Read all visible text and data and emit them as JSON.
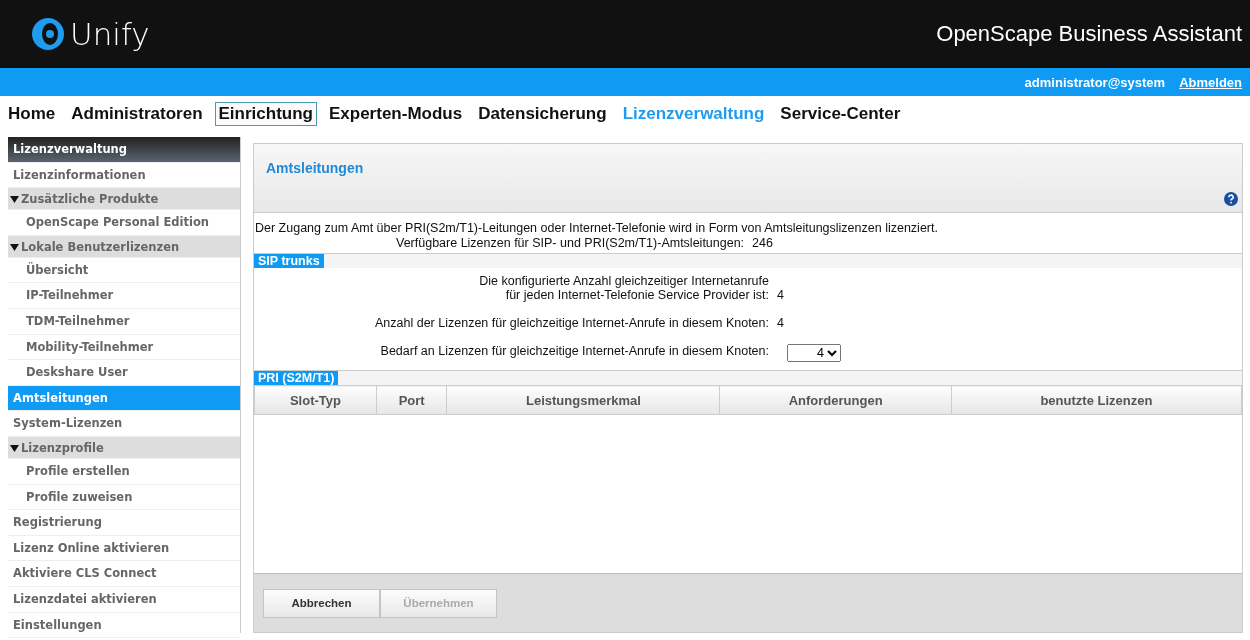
{
  "header": {
    "logo": "Unify",
    "product": "OpenScape Business Assistant"
  },
  "user_bar": {
    "user": "administrator@system",
    "logout": "Abmelden"
  },
  "nav": [
    {
      "label": "Home",
      "selected": false,
      "focused": false
    },
    {
      "label": "Administratoren",
      "selected": false,
      "focused": false
    },
    {
      "label": "Einrichtung",
      "selected": false,
      "focused": true
    },
    {
      "label": "Experten-Modus",
      "selected": false,
      "focused": false
    },
    {
      "label": "Datensicherung",
      "selected": false,
      "focused": false
    },
    {
      "label": "Lizenzverwaltung",
      "selected": true,
      "focused": false
    },
    {
      "label": "Service-Center",
      "selected": false,
      "focused": false
    }
  ],
  "sidebar": {
    "items": [
      {
        "kind": "header",
        "label": "Lizenzverwaltung",
        "selected": false
      },
      {
        "kind": "item",
        "label": "Lizenzinformationen",
        "selected": false
      },
      {
        "kind": "group",
        "label": "Zusätzliche Produkte",
        "expanded": true,
        "selected": false,
        "children": [
          {
            "kind": "subitem",
            "label": "OpenScape Personal Edition",
            "selected": false
          }
        ]
      },
      {
        "kind": "group",
        "label": "Lokale Benutzerlizenzen",
        "expanded": true,
        "selected": false,
        "children": [
          {
            "kind": "subitem",
            "label": "Übersicht",
            "selected": false
          },
          {
            "kind": "subitem",
            "label": "IP-Teilnehmer",
            "selected": false
          },
          {
            "kind": "subitem",
            "label": "TDM-Teilnehmer",
            "selected": false
          },
          {
            "kind": "subitem",
            "label": "Mobility-Teilnehmer",
            "selected": false
          },
          {
            "kind": "subitem",
            "label": "Deskshare User",
            "selected": false
          }
        ]
      },
      {
        "kind": "item",
        "label": "Amtsleitungen",
        "selected": true
      },
      {
        "kind": "item",
        "label": "System-Lizenzen",
        "selected": false
      },
      {
        "kind": "group",
        "label": "Lizenzprofile",
        "expanded": true,
        "selected": false,
        "children": [
          {
            "kind": "subitem",
            "label": "Profile erstellen",
            "selected": false
          },
          {
            "kind": "subitem",
            "label": "Profile zuweisen",
            "selected": false
          }
        ]
      },
      {
        "kind": "item",
        "label": "Registrierung",
        "selected": false
      },
      {
        "kind": "item",
        "label": "Lizenz Online aktivieren",
        "selected": false
      },
      {
        "kind": "item",
        "label": "Aktiviere CLS Connect",
        "selected": false
      },
      {
        "kind": "item",
        "label": "Lizenzdatei aktivieren",
        "selected": false
      },
      {
        "kind": "item",
        "label": "Einstellungen",
        "selected": false
      }
    ]
  },
  "panel": {
    "title": "Amtsleitungen",
    "intro": "Der Zugang zum Amt über PRI(S2m/T1)-Leitungen oder Internet-Telefonie wird in Form von Amtsleitungslizenzen lizenziert.",
    "available": {
      "label": "Verfügbare Lizenzen für SIP- und PRI(S2m/T1)-Amtsleitungen:",
      "value": "246"
    },
    "sip": {
      "title": "SIP trunks",
      "rows": [
        {
          "kind": "text",
          "label_lines": [
            "Die konfigurierte Anzahl gleichzeitiger Internetanrufe",
            "für jeden Internet-Telefonie Service Provider ist:"
          ],
          "value": "4"
        },
        {
          "kind": "text",
          "label_lines": [
            "Anzahl der Lizenzen für gleichzeitige Internet-Anrufe in diesem Knoten:"
          ],
          "value": "4"
        },
        {
          "kind": "select",
          "label_lines": [
            "Bedarf an Lizenzen für gleichzeitige Internet-Anrufe in diesem Knoten:"
          ],
          "value": "4"
        }
      ]
    },
    "pri": {
      "title": "PRI (S2M/T1)",
      "columns": [
        "Slot-Typ",
        "Port",
        "Leistungsmerkmal",
        "Anforderungen",
        "benutzte Lizenzen"
      ]
    },
    "buttons": [
      {
        "label": "Abbrechen",
        "disabled": false
      },
      {
        "label": "Übernehmen",
        "disabled": true
      }
    ]
  }
}
